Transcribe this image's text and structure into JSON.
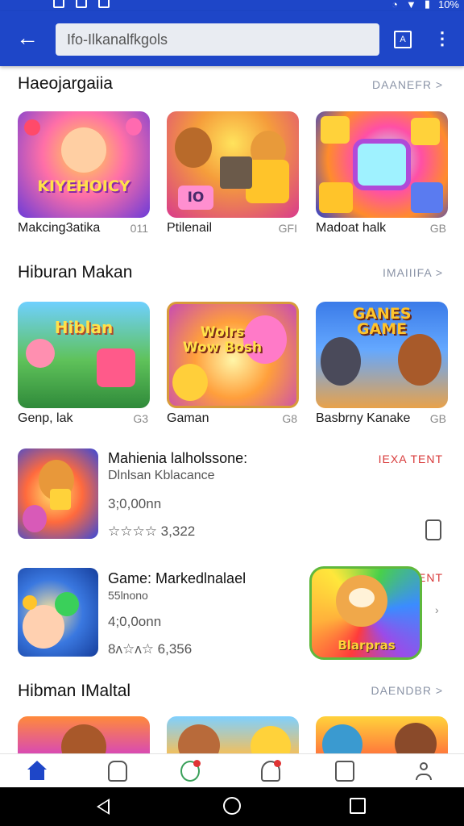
{
  "statusbar": {
    "battery": "10%"
  },
  "appbar": {
    "search_value": "Ifo-Ilkanalfkgols"
  },
  "sections": [
    {
      "title": "Haeojargaiia",
      "see_all": "DAANEFR >",
      "cards": [
        {
          "label": "Makcing3atika",
          "meta": "011",
          "art_text": "KIYEHOICY"
        },
        {
          "label": "Ptilenail",
          "meta": "GFI",
          "art_text": "IO"
        },
        {
          "label": "Madoat halk",
          "meta": "GB",
          "art_text": ""
        }
      ]
    },
    {
      "title": "Hiburan Makan",
      "see_all": "IMAIIIFA >",
      "cards": [
        {
          "label": "Genp, lak",
          "meta": "G3",
          "art_text": "Hiblan"
        },
        {
          "label": "Gaman",
          "meta": "G8",
          "art_text": "Wolrs Wow Bosh"
        },
        {
          "label": "Basbrny Kanake",
          "meta": "GB",
          "art_text": "GANES GAME"
        }
      ]
    },
    {
      "title": "Hibman IMaltal",
      "see_all": "DAENDBR >"
    }
  ],
  "list_items": [
    {
      "title": "Mahienia lalholssone:",
      "subtitle": "Dlnlsan Kblacance",
      "size": "3;0,00nn",
      "rating": "☆☆☆☆ 3,322",
      "tag": "IEXA TENT"
    },
    {
      "title": "Game: Markedlnalael",
      "subtitle": "55lnono",
      "size": "4;0,0onn",
      "rating": "8ʌ☆ʌ☆ 6,356",
      "tag": "IENT",
      "promo_art_text": "Blarpras"
    }
  ],
  "bottom_nav": [
    "home-icon",
    "bag-icon",
    "games-icon",
    "community-icon",
    "book-icon",
    "profile-icon"
  ],
  "colors": {
    "primary": "#1e46c8",
    "tag_red": "#d83a3a"
  }
}
